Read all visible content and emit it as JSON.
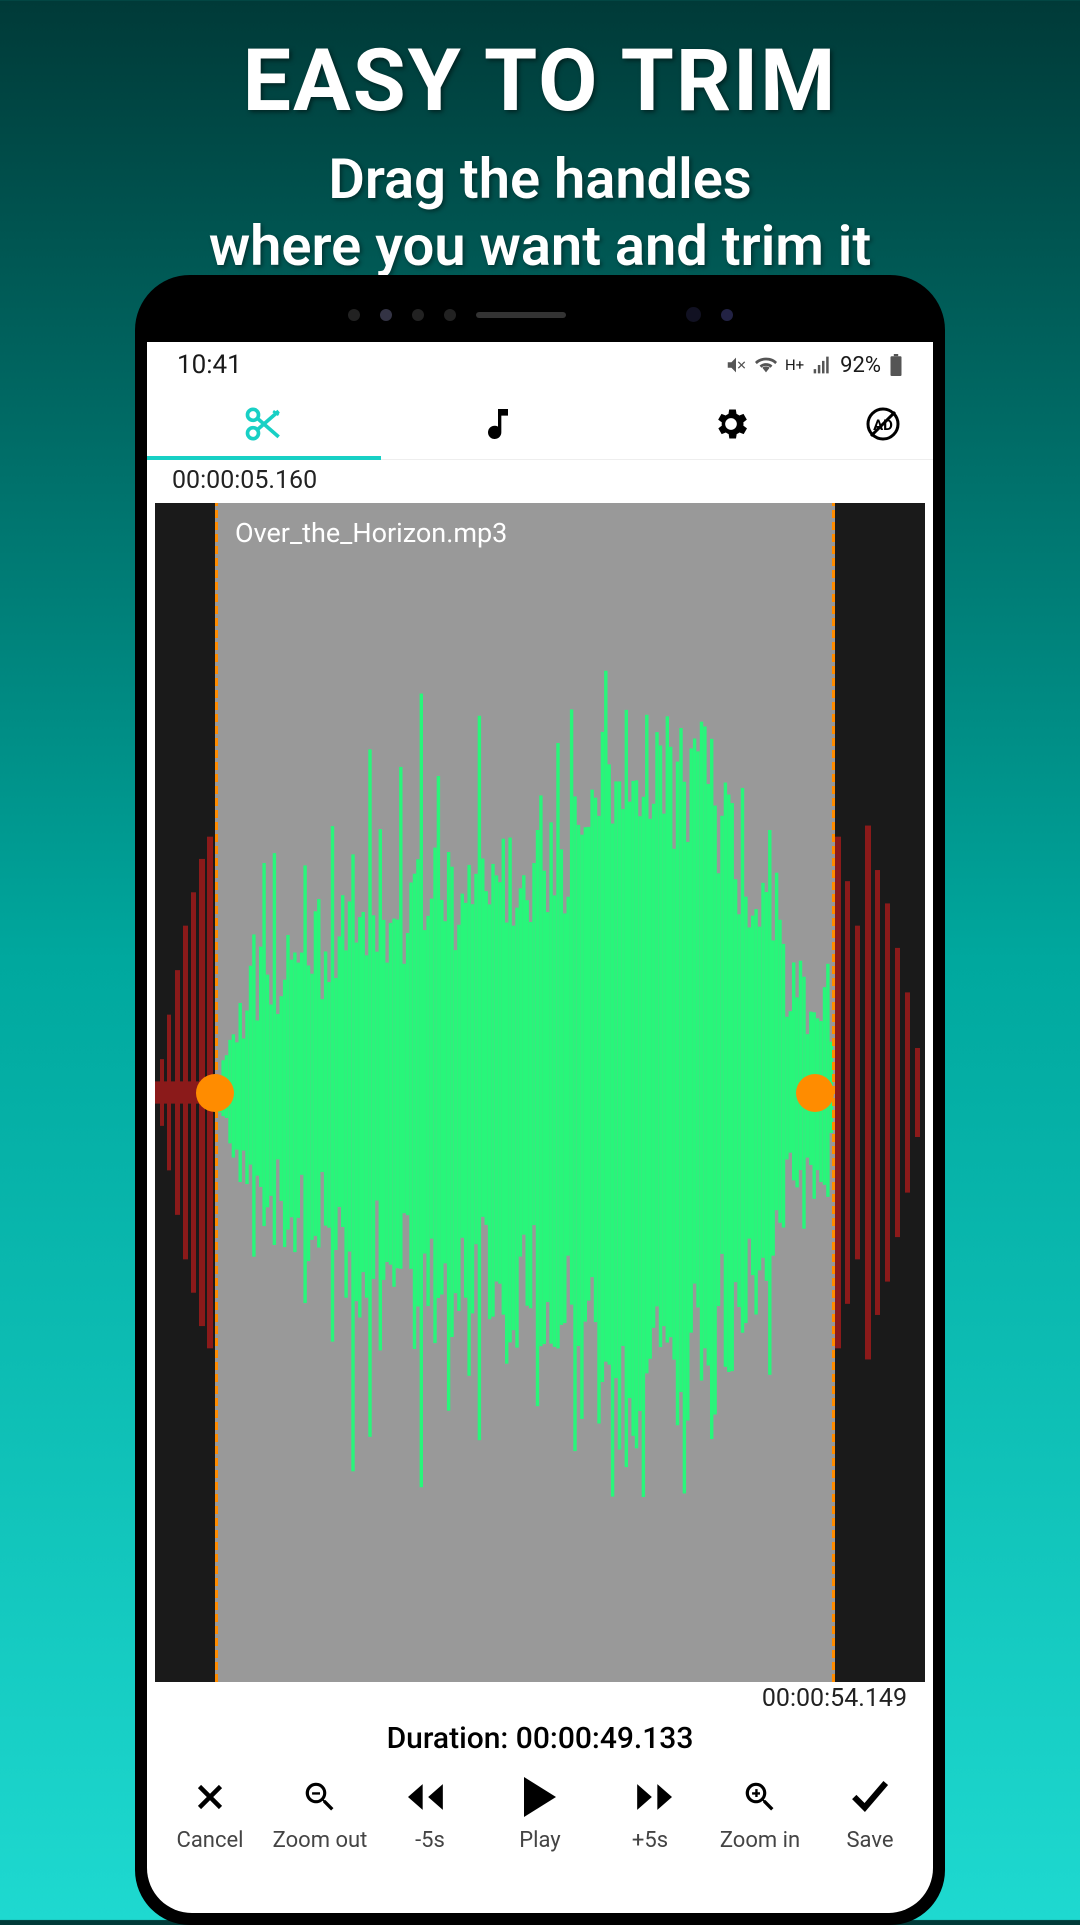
{
  "promo": {
    "title": "EASY TO TRIM",
    "subtitle_line1": "Drag the handles",
    "subtitle_line2": "where you want and trim it"
  },
  "status": {
    "time": "10:41",
    "battery": "92%"
  },
  "tabs": {
    "active": "cut"
  },
  "editor": {
    "start_time": "00:00:05.160",
    "end_time": "00:00:54.149",
    "filename": "Over_the_Horizon.mp3",
    "duration_label": "Duration: 00:00:49.133"
  },
  "controls": {
    "cancel": "Cancel",
    "zoom_out": "Zoom out",
    "minus5": "-5s",
    "play": "Play",
    "plus5": "+5s",
    "zoom_in": "Zoom in",
    "save": "Save"
  },
  "colors": {
    "accent": "#18d0c5",
    "handle": "#ff8c00",
    "wave_selected": "#28f67a",
    "wave_outside": "#8b1a1a"
  }
}
